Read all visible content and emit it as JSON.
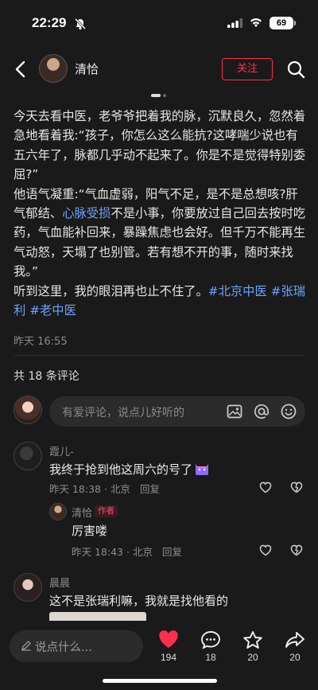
{
  "status_bar": {
    "time": "22:29",
    "battery": "69"
  },
  "header": {
    "author_name": "清恰",
    "follow_label": "关注"
  },
  "post": {
    "line1": "今天去看中医，老爷爷把着我的脉，沉默良久，忽然着急地看着我:“孩子，你怎么这么能抗?这哮喘少说也有五六年了，脉都几乎动不起来了。你是不是觉得特别委屈?”",
    "line2_pre": "他语气凝重:“气血虚弱，阳气不足，是不是总想咳?肝气郁结、",
    "line2_link": "心脉受损",
    "line2_post": "不是小事，你要放过自己回去按时吃药，气血能补回来，暴躁焦虑也会好。但千万不能再生气动怒，天塌了也别管。若有想不开的事，随时来找我。”",
    "line3_pre": "听到这里，我的眼泪再也止不住了。",
    "tag1": "#北京中医",
    "tag2": "#张瑞利",
    "tag3": "#老中医",
    "time": "昨天 16:55"
  },
  "comments_header": {
    "count_label": "共 18 条评论"
  },
  "comment_input": {
    "placeholder": "有爱评论，说点儿好听的"
  },
  "comments": [
    {
      "name": "霞儿-",
      "text": "我终于抢到他这周六的号了",
      "meta": "昨天 18:38 · 北京",
      "reply": "回复"
    },
    {
      "name": "清恰",
      "badge": "作者",
      "text": "厉害喽",
      "meta": "昨天 18:43 · 北京",
      "reply": "回复"
    },
    {
      "name": "晨晨",
      "text": "这不是张瑞利嘛，我就是找他看的"
    }
  ],
  "bottom_bar": {
    "comment_placeholder": "说点什么...",
    "likes": "194",
    "comments": "18",
    "stars": "20",
    "shares": "20"
  },
  "colors": {
    "accent": "#ff2e4d",
    "link": "#6ba3ff",
    "background": "#1a1a1a"
  }
}
